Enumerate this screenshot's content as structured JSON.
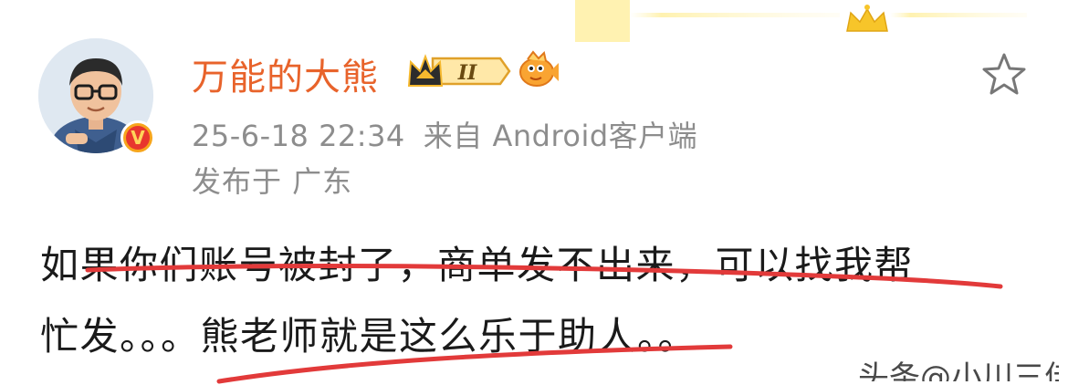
{
  "user": {
    "name": "万能的大熊",
    "rank_badge": "II",
    "verified_icon": "v-verified-badge-icon",
    "avatar_icon": "cartoon-avatar-icon",
    "fish_icon": "fish-emblem-icon",
    "crown_icon": "crown-rank-icon"
  },
  "post_meta": {
    "timestamp": "25-6-18 22:34",
    "source": "来自 Android客户端",
    "location": "发布于 广东"
  },
  "post_body": {
    "line1": "如果你们账号被封了，商单发不出来，可以找我帮",
    "line2": "忙发。。。熊老师就是这么乐于助人。。"
  },
  "actions": {
    "favorite_icon": "star-outline-icon"
  },
  "watermark": {
    "text": "头条@小川三佳"
  },
  "colors": {
    "username": "#e8632b",
    "meta": "#8d8d8d",
    "text": "#1a1a1a",
    "annotation": "#e23a3a",
    "badge_gold": "#f5b82e"
  }
}
